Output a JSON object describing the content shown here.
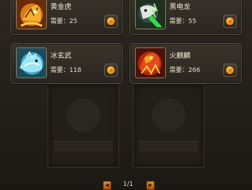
{
  "mounts": [
    {
      "name": "黄金虎",
      "cost_label": "需要：",
      "cost_value": "25",
      "icon": "golden-tiger-icon"
    },
    {
      "name": "黑电龙",
      "cost_label": "需要：",
      "cost_value": "55",
      "icon": "black-lightning-dragon-icon"
    },
    {
      "name": "冰玄武",
      "cost_label": "需要：",
      "cost_value": "118",
      "icon": "ice-black-tortoise-icon"
    },
    {
      "name": "火麒麟",
      "cost_label": "需要：",
      "cost_value": "266",
      "icon": "fire-qilin-icon"
    }
  ],
  "pager": {
    "text": "1/1",
    "prev_icon": "arrow-left-icon",
    "next_icon": "arrow-right-icon"
  },
  "colors": {
    "panel_bg": "#221e19",
    "card_border": "#5e5748",
    "coin_orange": "#f08a10",
    "text_light": "#f4ecd8"
  }
}
